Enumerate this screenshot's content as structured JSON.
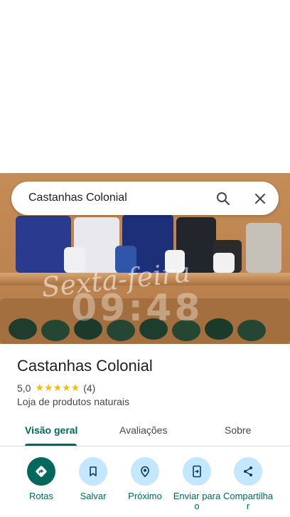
{
  "search": {
    "query": "Castanhas Colonial"
  },
  "photo": {
    "watermark_text": "Sexta-feira",
    "watermark_time": "09:48"
  },
  "place": {
    "title": "Castanhas Colonial",
    "rating": "5,0",
    "stars": "★★★★★",
    "review_count": "(4)",
    "category": "Loja de produtos naturais"
  },
  "tabs": [
    {
      "label": "Visão geral",
      "active": true
    },
    {
      "label": "Avaliações",
      "active": false
    },
    {
      "label": "Sobre",
      "active": false
    }
  ],
  "actions": [
    {
      "label": "Rotas",
      "icon": "directions-icon"
    },
    {
      "label": "Salvar",
      "icon": "bookmark-icon"
    },
    {
      "label": "Próximo",
      "icon": "nearby-icon"
    },
    {
      "label": "Enviar para o",
      "icon": "send-to-phone-icon"
    },
    {
      "label": "Compartilha r",
      "icon": "share-icon"
    }
  ],
  "colors": {
    "accent": "#00695c",
    "action_bg": "#c2e7ff",
    "star": "#fbbc04"
  }
}
